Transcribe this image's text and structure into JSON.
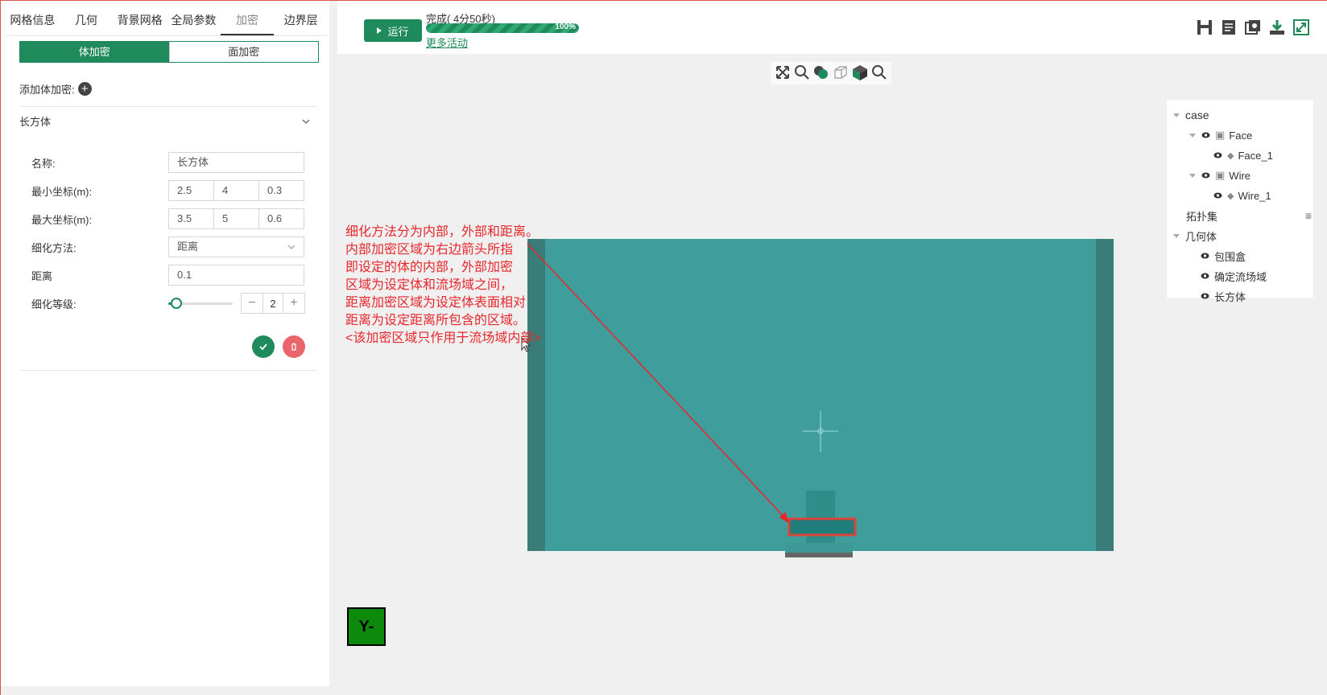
{
  "tabs": [
    {
      "label": "网格信息"
    },
    {
      "label": "几何"
    },
    {
      "label": "背景网格"
    },
    {
      "label": "全局参数"
    },
    {
      "label": "加密",
      "active": true
    },
    {
      "label": "边界层"
    }
  ],
  "segment": {
    "body_label": "体加密",
    "face_label": "面加密"
  },
  "add_body_label": "添加体加密:",
  "section_title": "长方体",
  "form": {
    "name_label": "名称:",
    "name_value": "长方体",
    "min_label": "最小坐标(m):",
    "min_values": [
      "2.5",
      "4",
      "0.3"
    ],
    "max_label": "最大坐标(m):",
    "max_values": [
      "3.5",
      "5",
      "0.6"
    ],
    "method_label": "细化方法:",
    "method_value": "距离",
    "distance_label": "距离",
    "distance_value": "0.1",
    "level_label": "细化等级:",
    "level_value": "2",
    "level_slider_fraction": 0.12
  },
  "topbar": {
    "run_label": "运行",
    "status_text": "完成( 4分50秒)",
    "progress_percent": 100,
    "progress_label": "100%",
    "more_label": "更多活动"
  },
  "tree": {
    "root": "case",
    "face": "Face",
    "face_1": "Face_1",
    "wire": "Wire",
    "wire_1": "Wire_1",
    "topo": "拓扑集",
    "geom": "几何体",
    "g1": "包围盒",
    "g2": "确定流场域",
    "g3": "长方体"
  },
  "axis_label": "Y-",
  "annotation": [
    "细化方法分为内部，外部和距离。",
    "内部加密区域为右边箭头所指",
    "即设定的体的内部，外部加密",
    "区域为设定体和流场域之间，",
    "距离加密区域为设定体表面相对",
    "距离为设定距离所包含的区域。",
    "<该加密区域只作用于流场域内部>"
  ],
  "colors": {
    "accent": "#1f8a5b",
    "delete": "#e8666b",
    "annotation": "#e8262b",
    "teal": "#3f9d9c"
  }
}
